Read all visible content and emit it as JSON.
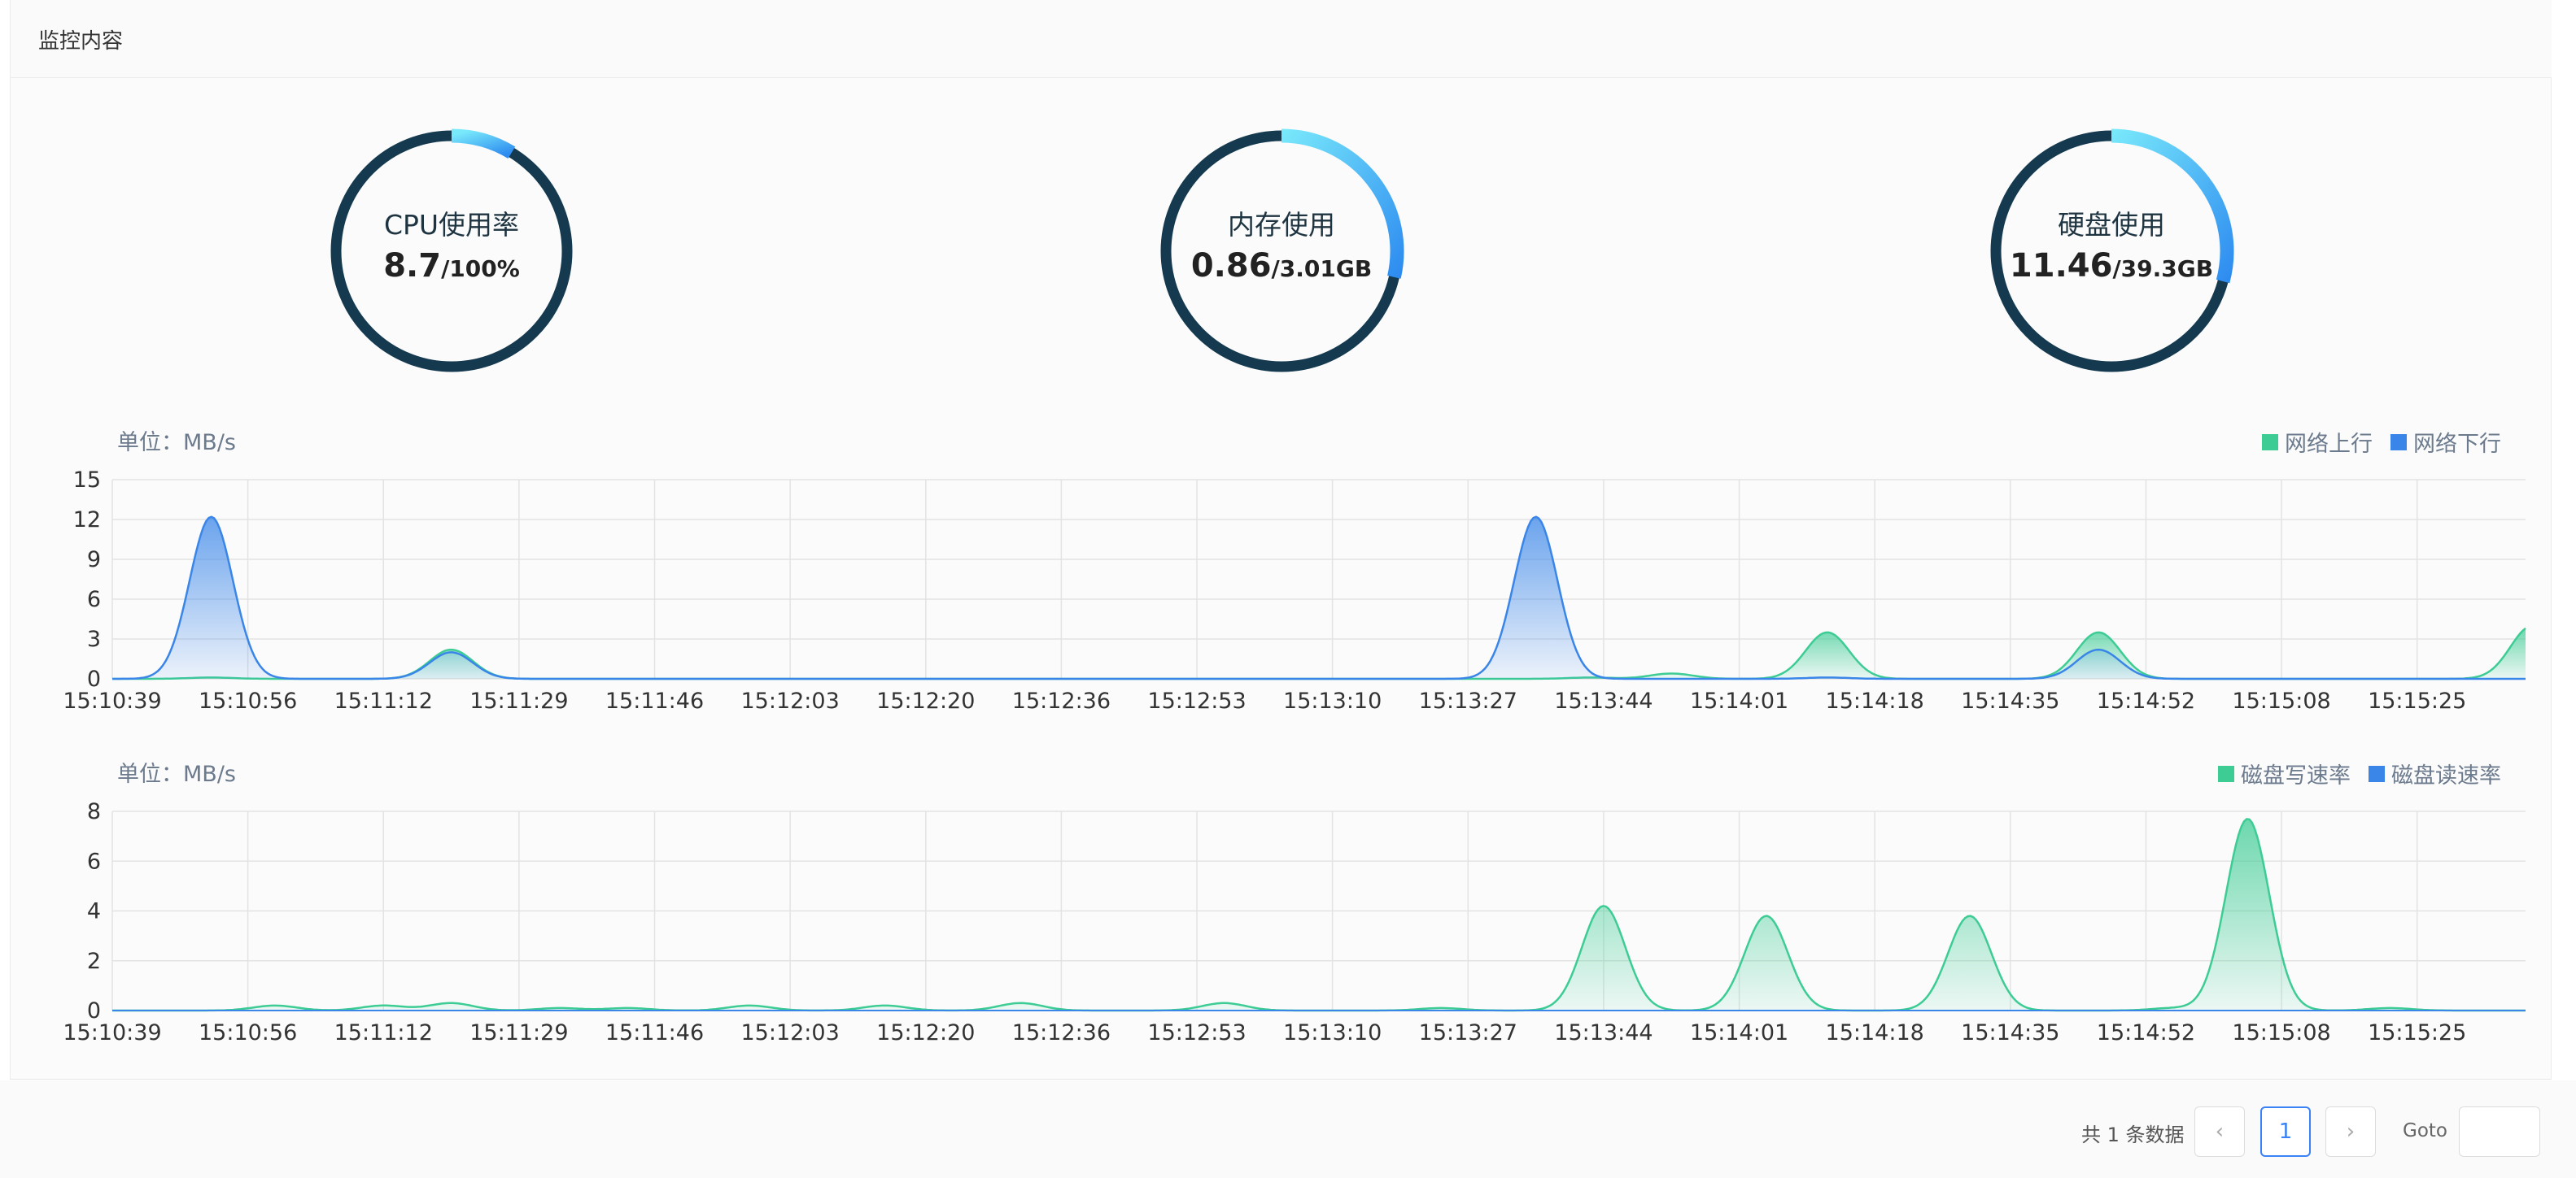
{
  "header": {
    "title": "监控内容"
  },
  "gauges": [
    {
      "label": "CPU使用率",
      "used": "8.7",
      "total": "/100%",
      "ratio": 0.087
    },
    {
      "label": "内存使用",
      "used": "0.86",
      "total": "/3.01GB",
      "ratio": 0.286
    },
    {
      "label": "硬盘使用",
      "used": "11.46",
      "total": "/39.3GB",
      "ratio": 0.292
    }
  ],
  "colors": {
    "gauge_track": "#153a4f",
    "gauge_start": "#78e8fb",
    "gauge_end": "#2e8cf0",
    "green": "#3dcc94",
    "blue": "#3a86e8"
  },
  "chart_data": [
    {
      "type": "area",
      "unit_label": "单位：MB/s",
      "ylim": [
        0,
        15
      ],
      "yticks": [
        0,
        3,
        6,
        9,
        12,
        15
      ],
      "x_labels": [
        "15:10:39",
        "15:10:56",
        "15:11:12",
        "15:11:29",
        "15:11:46",
        "15:12:03",
        "15:12:20",
        "15:12:36",
        "15:12:53",
        "15:13:10",
        "15:13:27",
        "15:13:44",
        "15:14:01",
        "15:14:18",
        "15:14:35",
        "15:14:52",
        "15:15:08",
        "15:15:25"
      ],
      "grid": true,
      "legend_position": "top-right",
      "series": [
        {
          "name": "网络上行",
          "color": "#3dcc94",
          "peaks": [
            [
              0.73,
              0.1
            ],
            [
              2.5,
              2.2
            ],
            [
              10.9,
              0.1
            ],
            [
              11.5,
              0.4
            ],
            [
              12.65,
              3.5
            ],
            [
              14.65,
              3.5
            ],
            [
              17.85,
              4.0
            ]
          ]
        },
        {
          "name": "网络下行",
          "color": "#3a86e8",
          "peaks": [
            [
              0.73,
              12.2
            ],
            [
              2.5,
              2.0
            ],
            [
              10.5,
              12.2
            ],
            [
              12.65,
              0.1
            ],
            [
              14.65,
              2.2
            ]
          ]
        }
      ]
    },
    {
      "type": "area",
      "unit_label": "单位：MB/s",
      "ylim": [
        0,
        8
      ],
      "yticks": [
        0,
        2,
        4,
        6,
        8
      ],
      "x_labels": [
        "15:10:39",
        "15:10:56",
        "15:11:12",
        "15:11:29",
        "15:11:46",
        "15:12:03",
        "15:12:20",
        "15:12:36",
        "15:12:53",
        "15:13:10",
        "15:13:27",
        "15:13:44",
        "15:14:01",
        "15:14:18",
        "15:14:35",
        "15:14:52",
        "15:15:08",
        "15:15:25"
      ],
      "grid": true,
      "legend_position": "top-right",
      "series": [
        {
          "name": "磁盘写速率",
          "color": "#3dcc94",
          "peaks": [
            [
              1.2,
              0.2
            ],
            [
              2.0,
              0.2
            ],
            [
              2.5,
              0.3
            ],
            [
              3.3,
              0.1
            ],
            [
              3.8,
              0.1
            ],
            [
              4.7,
              0.2
            ],
            [
              5.7,
              0.2
            ],
            [
              6.7,
              0.3
            ],
            [
              8.2,
              0.3
            ],
            [
              9.8,
              0.1
            ],
            [
              11.0,
              4.2
            ],
            [
              12.2,
              3.8
            ],
            [
              13.7,
              3.8
            ],
            [
              15.2,
              0.1
            ],
            [
              15.75,
              7.7
            ],
            [
              16.8,
              0.1
            ]
          ]
        },
        {
          "name": "磁盘读速率",
          "color": "#3a86e8",
          "peaks": []
        }
      ]
    }
  ],
  "footer": {
    "total_text": "共 1 条数据",
    "prev": "‹",
    "page": "1",
    "next": "›",
    "goto_label": "Goto"
  }
}
